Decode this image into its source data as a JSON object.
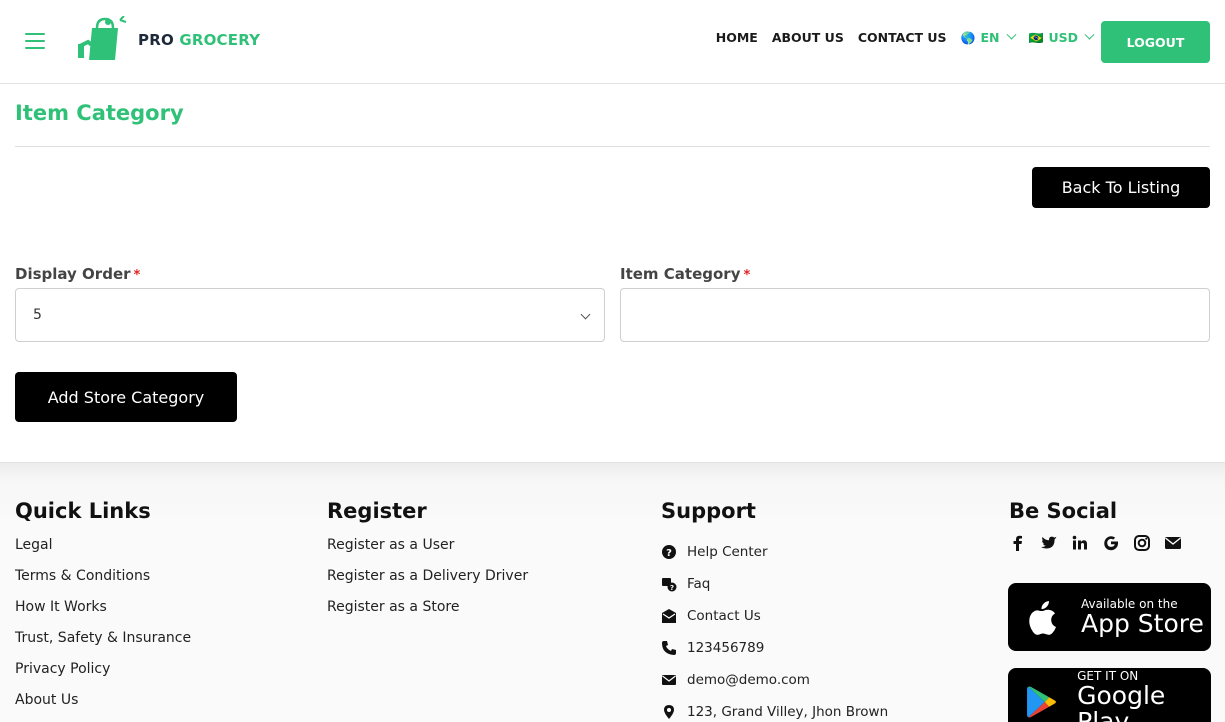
{
  "header": {
    "brand_pro": "PRO",
    "brand_grocery": "GROCERY",
    "nav": [
      "HOME",
      "ABOUT US",
      "CONTACT US"
    ],
    "language": {
      "glyph": "🌎",
      "value": "EN"
    },
    "currency": {
      "glyph": "🇧🇷",
      "value": "USD"
    },
    "logout_label": "LOGOUT"
  },
  "main": {
    "title": "Item Category",
    "back_label": "Back To Listing",
    "display_order": {
      "label": "Display Order",
      "required_mark": "*",
      "value": "5"
    },
    "item_category": {
      "label": "Item Category",
      "required_mark": "*",
      "value": "",
      "placeholder": ""
    },
    "submit_label": "Add Store Category"
  },
  "footer": {
    "quick_links": {
      "title": "Quick Links",
      "items": [
        "Legal",
        "Terms & Conditions",
        "How It Works",
        "Trust, Safety & Insurance",
        "Privacy Policy",
        "About Us"
      ]
    },
    "register": {
      "title": "Register",
      "items": [
        "Register as a User",
        "Register as a Delivery Driver",
        "Register as a Store"
      ]
    },
    "support": {
      "title": "Support",
      "items": [
        {
          "icon": "question-circle-icon",
          "label": "Help Center"
        },
        {
          "icon": "faq-icon",
          "label": "Faq"
        },
        {
          "icon": "contact-envelope-icon",
          "label": "Contact Us"
        },
        {
          "icon": "phone-icon",
          "label": "123456789"
        },
        {
          "icon": "envelope-icon",
          "label": "demo@demo.com"
        },
        {
          "icon": "map-marker-icon",
          "label": "123, Grand Villey, Jhon Brown"
        }
      ]
    },
    "social": {
      "title": "Be Social",
      "icons": [
        "facebook-icon",
        "twitter-icon",
        "linkedin-icon",
        "google-icon",
        "instagram-icon",
        "envelope-icon"
      ]
    },
    "app_store": {
      "small": "Available on the",
      "big": "App Store"
    },
    "google_play": {
      "small": "GET IT ON",
      "big": "Google Play"
    }
  },
  "colors": {
    "accent": "#30c178",
    "button_dark": "#000000",
    "required": "#e02424"
  }
}
